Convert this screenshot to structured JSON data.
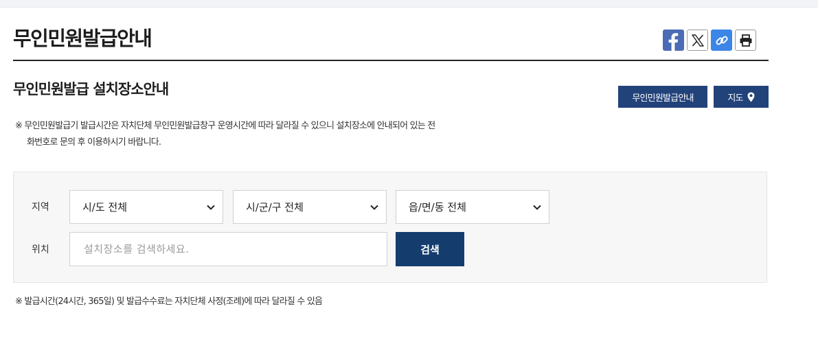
{
  "page": {
    "title": "무인민원발급안내"
  },
  "section": {
    "title": "무인민원발급 설치장소안내"
  },
  "buttons": {
    "guide": "무인민원발급안내",
    "map": "지도"
  },
  "notice": {
    "line1": "※ 무인민원발급기 발급시간은 자치단체 무인민원발급창구 운영시간에 따라 달라질 수 있으니 설치장소에 안내되어 있는 전",
    "line2": "화번호로 문의 후 이용하시기 바랍니다."
  },
  "search": {
    "region_label": "지역",
    "location_label": "위치",
    "sido": "시/도 전체",
    "sigungu": "시/군/구 전체",
    "eupmyeondong": "읍/면/동 전체",
    "placeholder": "설치장소를 검색하세요.",
    "button": "검색"
  },
  "footnote": "※ 발급시간(24시간, 365일) 및 발급수수료는 자치단체 사정(조례)에 따라 달라질 수 있음",
  "icons": {
    "share": [
      "facebook-icon",
      "x-twitter-icon",
      "link-icon",
      "print-icon"
    ],
    "map": "map-pin-icon",
    "select": "chevron-down-icon"
  },
  "colors": {
    "navy": "#22427a",
    "search_button": "#143d6e",
    "facebook": "#4a6cb4",
    "link": "#3c86e8"
  }
}
